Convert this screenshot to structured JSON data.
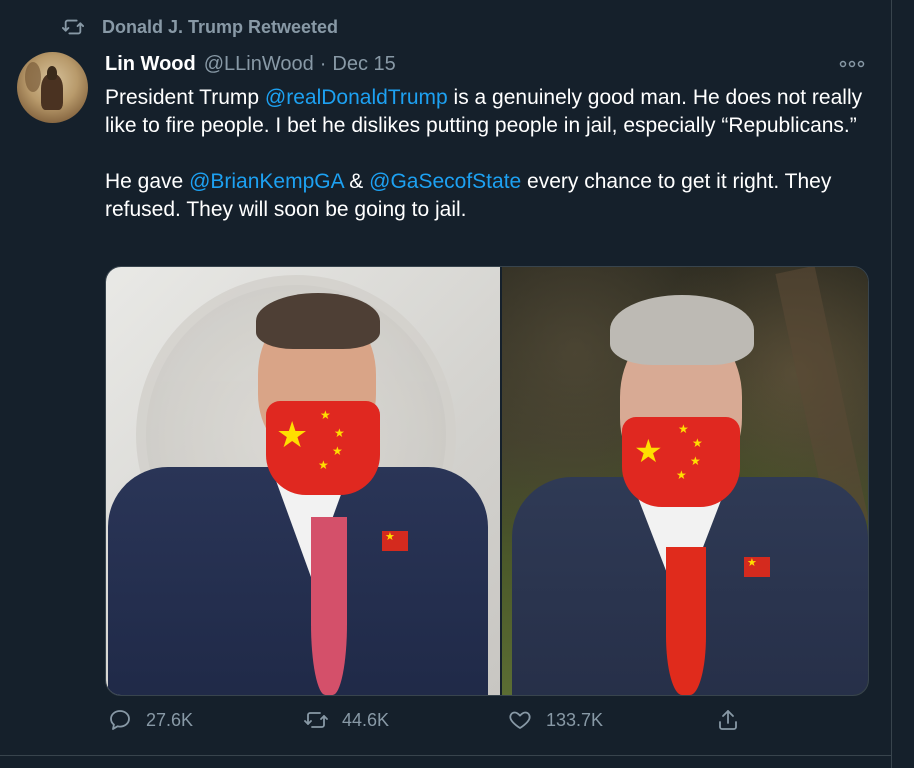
{
  "retweet": {
    "label": "Donald J. Trump Retweeted",
    "icon": "retweet-icon"
  },
  "author": {
    "name": "Lin Wood",
    "handle": "@LLinWood",
    "separator": "·",
    "date": "Dec 15"
  },
  "tweet": {
    "p1_a": "President Trump ",
    "p1_mention": "@realDonaldTrump",
    "p1_b": " is a genuinely good man. He does not really like to fire people. I bet he dislikes putting people in jail, especially “Republicans.”",
    "p2_a": "He gave ",
    "p2_mention1": "@BrianKempGA",
    "p2_b": " & ",
    "p2_mention2": "@GaSecofState",
    "p2_c": " every chance to get it right. They refused. They will soon be going to jail."
  },
  "actions": {
    "reply_count": "27.6K",
    "retweet_count": "44.6K",
    "like_count": "133.7K"
  },
  "colors": {
    "background": "#15202b",
    "accent": "#1da1f2",
    "muted": "#8899a6",
    "border": "#38444d"
  },
  "icons": [
    "retweet-icon",
    "more-icon",
    "reply-icon",
    "like-icon",
    "share-icon"
  ]
}
